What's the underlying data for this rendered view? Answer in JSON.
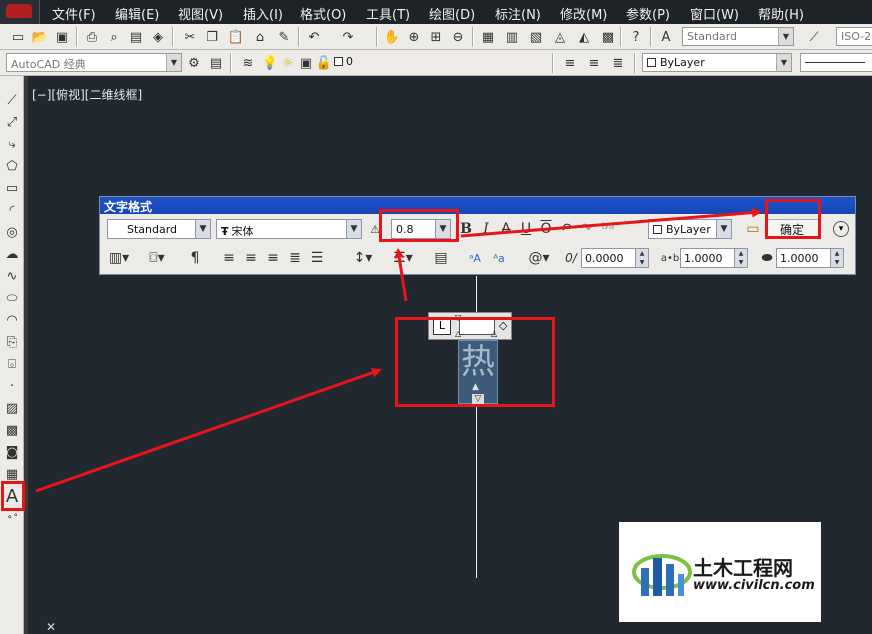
{
  "menubar": {
    "items": [
      "文件(F)",
      "编辑(E)",
      "视图(V)",
      "插入(I)",
      "格式(O)",
      "工具(T)",
      "绘图(D)",
      "标注(N)",
      "修改(M)",
      "参数(P)",
      "窗口(W)",
      "帮助(H)"
    ]
  },
  "toolbar1": {
    "text_style": "Standard",
    "dim_style": "ISO-2"
  },
  "toolbar2": {
    "workspace": "AutoCAD 经典",
    "layer_value": "0",
    "color_value": "ByLayer"
  },
  "viewport": {
    "label": "[−][俯视][二维线框]"
  },
  "text_format": {
    "title": "文字格式",
    "style": "Standard",
    "font": "宋体",
    "height": "0.8",
    "color": "ByLayer",
    "ok_label": "确定",
    "bold_label": "B",
    "italic_label": "I",
    "underline_label": "U",
    "overline_label": "O",
    "oblique": "0.0000",
    "tracking": "1.0000",
    "width": "1.0000"
  },
  "editor": {
    "text": "热"
  },
  "watermark": {
    "title": "土木工程网",
    "url": "www.civilcn.com"
  },
  "colors": {
    "annotation_red": "#e8141a",
    "canvas": "#212830",
    "title_blue": "#1d53c9"
  }
}
